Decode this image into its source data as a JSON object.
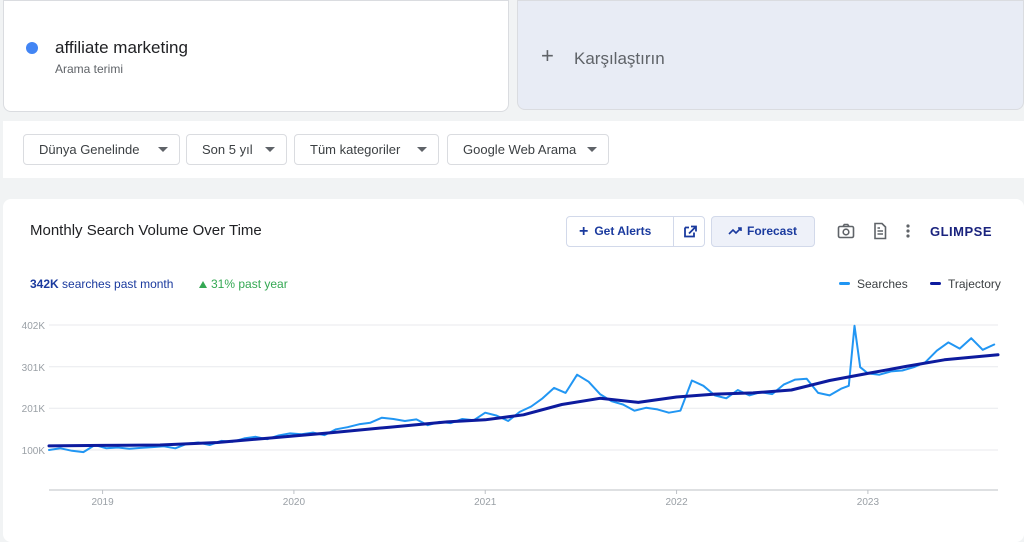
{
  "term": {
    "name": "affiliate marketing",
    "subtitle": "Arama terimi",
    "color": "#4285f4"
  },
  "compare": {
    "label": "Karşılaştırın"
  },
  "filters": [
    {
      "label": "Dünya Genelinde"
    },
    {
      "label": "Son 5 yıl"
    },
    {
      "label": "Tüm kategoriler"
    },
    {
      "label": "Google Web Arama"
    }
  ],
  "chart_card": {
    "title": "Monthly Search Volume Over Time",
    "get_alerts_label": "Get Alerts",
    "forecast_label": "Forecast",
    "brand": "GLIMPSE",
    "stat_value": "342K",
    "stat_text": "searches past month",
    "growth_text": "31% past year",
    "legend": [
      {
        "name": "Searches",
        "color": "#2196f3"
      },
      {
        "name": "Trajectory",
        "color": "#0d1b9e"
      }
    ],
    "icons": [
      "plus-icon",
      "external-link-icon",
      "trend-icon",
      "camera-icon",
      "document-icon",
      "more-vert-icon"
    ]
  },
  "chart_data": {
    "type": "line",
    "title": "Monthly Search Volume Over Time",
    "y_ticks": [
      "100K",
      "201K",
      "301K",
      "402K"
    ],
    "y_tick_values": [
      100000,
      201000,
      301000,
      402000
    ],
    "x_tick_labels": [
      "2019",
      "2020",
      "2021",
      "2022",
      "2023"
    ],
    "x_tick_values": [
      2019.0,
      2020.0,
      2021.0,
      2022.0,
      2023.0
    ],
    "x_range": [
      2018.72,
      2023.68
    ],
    "y_range": [
      0,
      402000
    ],
    "grid": true,
    "legend_position": "top-right",
    "series": [
      {
        "name": "Searches",
        "color": "#2196f3",
        "x": [
          2018.72,
          2018.78,
          2018.84,
          2018.9,
          2018.96,
          2019.02,
          2019.08,
          2019.14,
          2019.2,
          2019.26,
          2019.32,
          2019.38,
          2019.44,
          2019.5,
          2019.56,
          2019.62,
          2019.68,
          2019.74,
          2019.8,
          2019.86,
          2019.92,
          2019.98,
          2020.04,
          2020.1,
          2020.16,
          2020.22,
          2020.28,
          2020.34,
          2020.4,
          2020.46,
          2020.52,
          2020.58,
          2020.64,
          2020.7,
          2020.76,
          2020.82,
          2020.88,
          2020.94,
          2021.0,
          2021.06,
          2021.12,
          2021.18,
          2021.24,
          2021.3,
          2021.36,
          2021.42,
          2021.48,
          2021.54,
          2021.6,
          2021.66,
          2021.72,
          2021.78,
          2021.84,
          2021.9,
          2021.96,
          2022.02,
          2022.08,
          2022.14,
          2022.2,
          2022.26,
          2022.32,
          2022.38,
          2022.44,
          2022.5,
          2022.56,
          2022.62,
          2022.68,
          2022.74,
          2022.8,
          2022.86,
          2022.9,
          2022.93,
          2022.96,
          2023.0,
          2023.06,
          2023.12,
          2023.18,
          2023.24,
          2023.3,
          2023.36,
          2023.42,
          2023.48,
          2023.54,
          2023.6,
          2023.66
        ],
        "values": [
          100000,
          104000,
          98000,
          95000,
          112000,
          104000,
          106000,
          103000,
          105000,
          107000,
          109000,
          104000,
          115000,
          118000,
          112000,
          122000,
          120000,
          128000,
          132000,
          126000,
          135000,
          140000,
          138000,
          142000,
          136000,
          150000,
          155000,
          162000,
          166000,
          178000,
          175000,
          170000,
          174000,
          160000,
          168000,
          165000,
          175000,
          172000,
          190000,
          183000,
          170000,
          192000,
          205000,
          225000,
          250000,
          238000,
          282000,
          265000,
          235000,
          218000,
          210000,
          195000,
          202000,
          198000,
          190000,
          195000,
          268000,
          255000,
          232000,
          225000,
          245000,
          232000,
          240000,
          235000,
          258000,
          270000,
          272000,
          238000,
          232000,
          248000,
          255000,
          400000,
          300000,
          285000,
          282000,
          290000,
          292000,
          300000,
          312000,
          340000,
          360000,
          345000,
          370000,
          342000,
          355000
        ]
      },
      {
        "name": "Trajectory",
        "color": "#0d1b9e",
        "x": [
          2018.72,
          2019.0,
          2019.3,
          2019.6,
          2019.9,
          2020.2,
          2020.5,
          2020.8,
          2021.0,
          2021.2,
          2021.4,
          2021.6,
          2021.8,
          2022.0,
          2022.2,
          2022.4,
          2022.6,
          2022.8,
          2023.0,
          2023.2,
          2023.4,
          2023.68
        ],
        "values": [
          110000,
          111000,
          112000,
          118000,
          130000,
          142000,
          155000,
          168000,
          173000,
          185000,
          210000,
          225000,
          215000,
          228000,
          235000,
          238000,
          245000,
          268000,
          285000,
          302000,
          318000,
          330000
        ]
      }
    ]
  }
}
